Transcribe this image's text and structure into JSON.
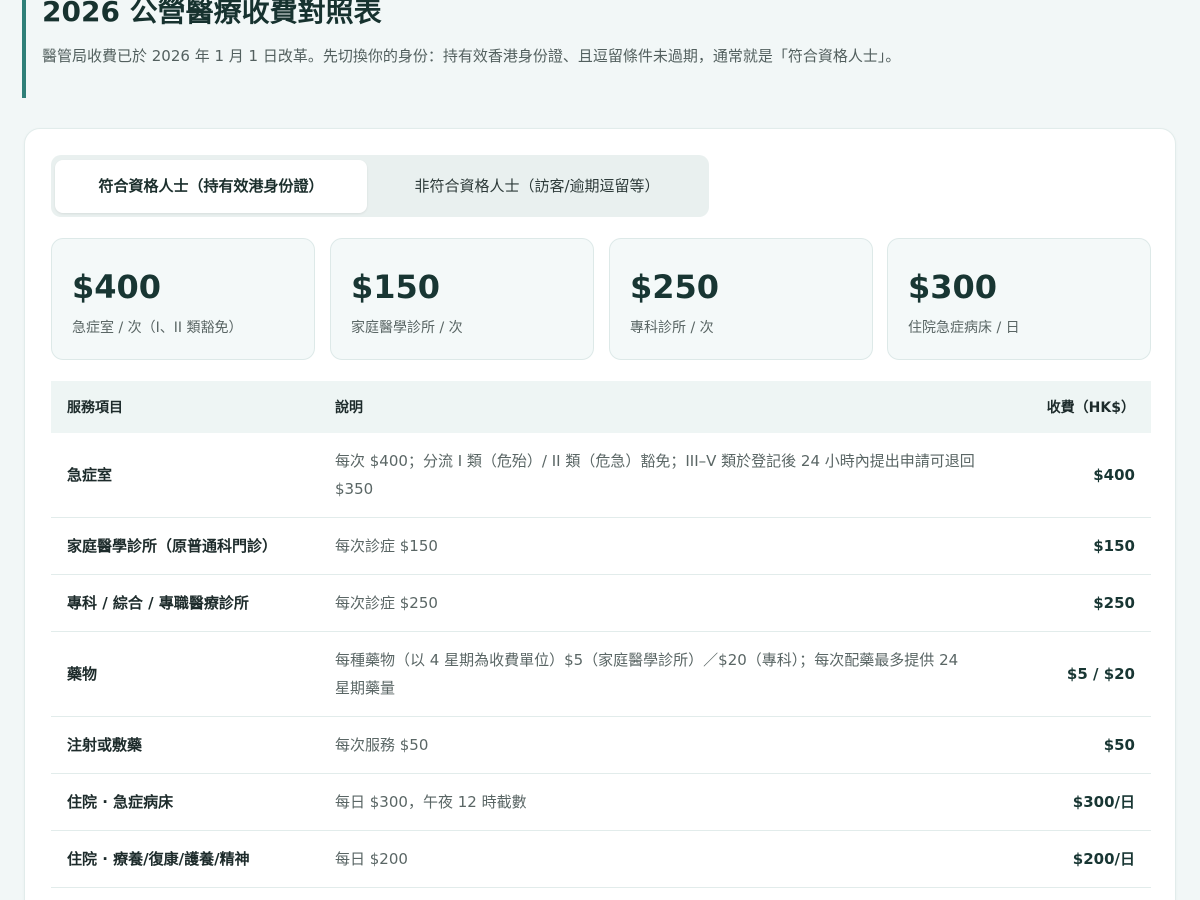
{
  "header": {
    "title": "2026 公營醫療收費對照表",
    "subtitle": "醫管局收費已於 2026 年 1 月 1 日改革。先切換你的身份：持有效香港身份證、且逗留條件未過期，通常就是「符合資格人士」。"
  },
  "tabs": [
    {
      "label": "符合資格人士（持有效港身份證）",
      "active": true
    },
    {
      "label": "非符合資格人士（訪客/逾期逗留等）",
      "active": false
    }
  ],
  "stats": [
    {
      "value": "$400",
      "label": "急症室 / 次（I、II 類豁免）"
    },
    {
      "value": "$150",
      "label": "家庭醫學診所 / 次"
    },
    {
      "value": "$250",
      "label": "專科診所 / 次"
    },
    {
      "value": "$300",
      "label": "住院急症病床 / 日"
    }
  ],
  "table": {
    "headers": [
      "服務項目",
      "說明",
      "收費（HK$）"
    ],
    "rows": [
      {
        "item": "急症室",
        "desc": "每次 $400；分流 I 類（危殆）/ II 類（危急）豁免；III–V 類於登記後 24 小時內提出申請可退回 $350",
        "fee": "$400"
      },
      {
        "item": "家庭醫學診所（原普通科門診）",
        "desc": "每次診症 $150",
        "fee": "$150"
      },
      {
        "item": "專科 / 綜合 / 專職醫療診所",
        "desc": "每次診症 $250",
        "fee": "$250"
      },
      {
        "item": "藥物",
        "desc": "每種藥物（以 4 星期為收費單位）$5（家庭醫學診所）／$20（專科）；每次配藥最多提供 24 星期藥量",
        "fee": "$5 / $20"
      },
      {
        "item": "注射或敷藥",
        "desc": "每次服務 $50",
        "fee": "$50"
      },
      {
        "item": "住院 · 急症病床",
        "desc": "每日 $300，午夜 12 時截數",
        "fee": "$300/日"
      },
      {
        "item": "住院 · 療養/復康/護養/精神",
        "desc": "每日 $200",
        "fee": "$200/日"
      }
    ]
  }
}
